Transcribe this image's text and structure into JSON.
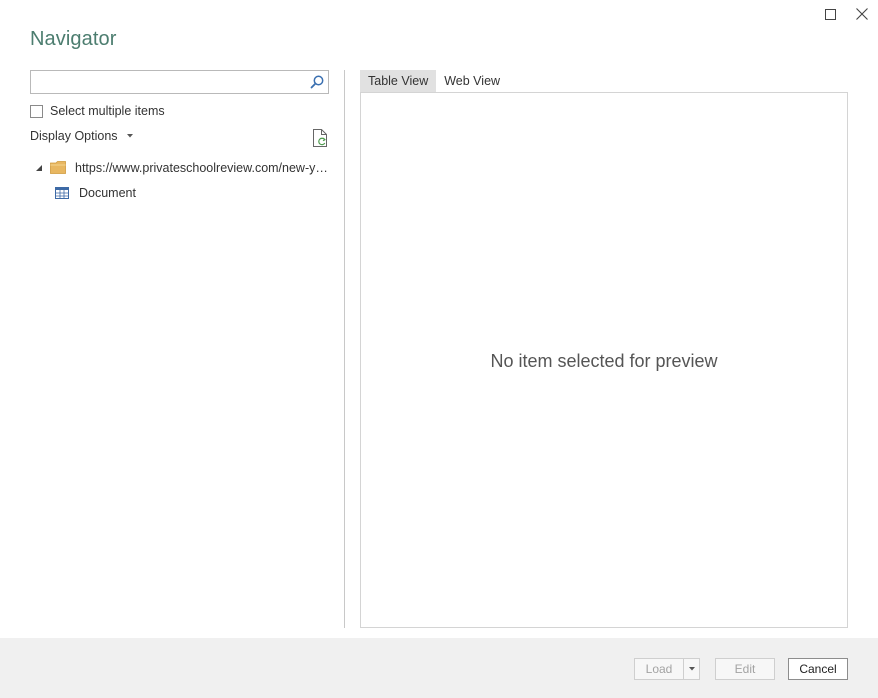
{
  "window": {
    "title": "Navigator",
    "controls": {
      "maximize_icon": "maximize-icon",
      "close_icon": "close-icon"
    }
  },
  "sidebar": {
    "search": {
      "value": "",
      "placeholder": "",
      "icon": "search-icon"
    },
    "select_multiple_label": "Select multiple items",
    "select_multiple_checked": false,
    "display_options_label": "Display Options",
    "tree": {
      "root": {
        "label": "https://www.privateschoolreview.com/new-yor...",
        "icon": "folder-icon",
        "expanded": true
      },
      "children": [
        {
          "label": "Document",
          "icon": "table-icon"
        }
      ]
    }
  },
  "preview": {
    "tabs": [
      {
        "label": "Table View",
        "active": true
      },
      {
        "label": "Web View",
        "active": false
      }
    ],
    "empty_message": "No item selected for preview"
  },
  "footer": {
    "load_label": "Load",
    "edit_label": "Edit",
    "cancel_label": "Cancel"
  },
  "colors": {
    "title": "#4c7d6f",
    "folder": "#e8b761",
    "table_icon": "#3d6aa6",
    "footer_bg": "#f0f0f0",
    "active_tab_bg": "#e1e1e1"
  }
}
